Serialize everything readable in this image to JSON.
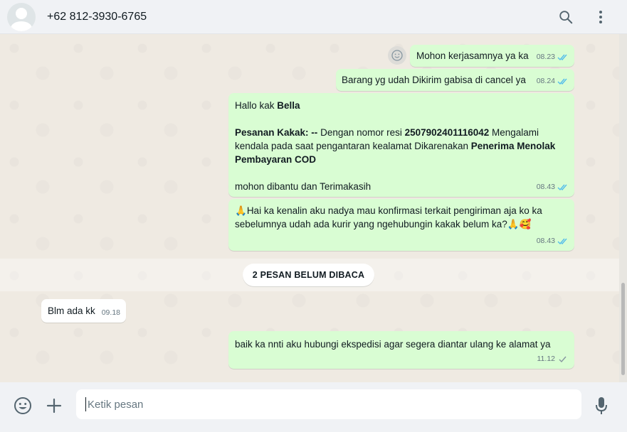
{
  "header": {
    "contact_name": "+62 812-3930-6765",
    "icons": [
      "search-icon",
      "menu-dots-icon"
    ]
  },
  "messages": [
    {
      "direction": "out",
      "text": "Mohon kerjasamnya ya ka",
      "time": "08.23",
      "status": "read"
    },
    {
      "direction": "out",
      "text": "Barang yg udah Dikirim gabisa di cancel ya",
      "time": "08.24",
      "status": "read"
    },
    {
      "direction": "out",
      "time": "08.43",
      "status": "read",
      "greeting_prefix": "Hallo kak ",
      "greeting_name": "Bella",
      "p1_label": "Pesanan Kakak: --",
      "p1_mid": " Dengan nomor resi ",
      "p1_resi": "2507902401116042",
      "p1_after": " Mengalami kendala pada saat pengantaran kealamat Dikarenakan ",
      "p1_reason": "Penerima Menolak Pembayaran COD",
      "closing": " mohon dibantu dan Terimakasih"
    },
    {
      "direction": "out",
      "time": "08.43",
      "status": "read",
      "emoji_start": "🙏",
      "text": "Hai ka kenalin aku nadya mau konfirmasi terkait pengiriman aja ko ka sebelumnya udah ada kurir yang ngehubungin kakak belum ka?",
      "emoji_end": "🙏🥰"
    },
    {
      "direction": "in",
      "text": "Blm ada kk",
      "time": "09.18"
    },
    {
      "direction": "out",
      "text": "baik ka nnti aku hubungi ekspedisi agar segera diantar ulang ke alamat ya",
      "time": "11.12",
      "status": "sent"
    }
  ],
  "unread_divider": "2 PESAN BELUM DIBACA",
  "composer": {
    "placeholder": "Ketik pesan",
    "value": "",
    "icons": [
      "emoji-icon",
      "attach-plus-icon",
      "microphone-icon"
    ]
  },
  "colors": {
    "outgoing_bubble": "#d9fdd3",
    "incoming_bubble": "#ffffff",
    "read_tick": "#53bdeb",
    "chat_background": "#efeae2"
  }
}
